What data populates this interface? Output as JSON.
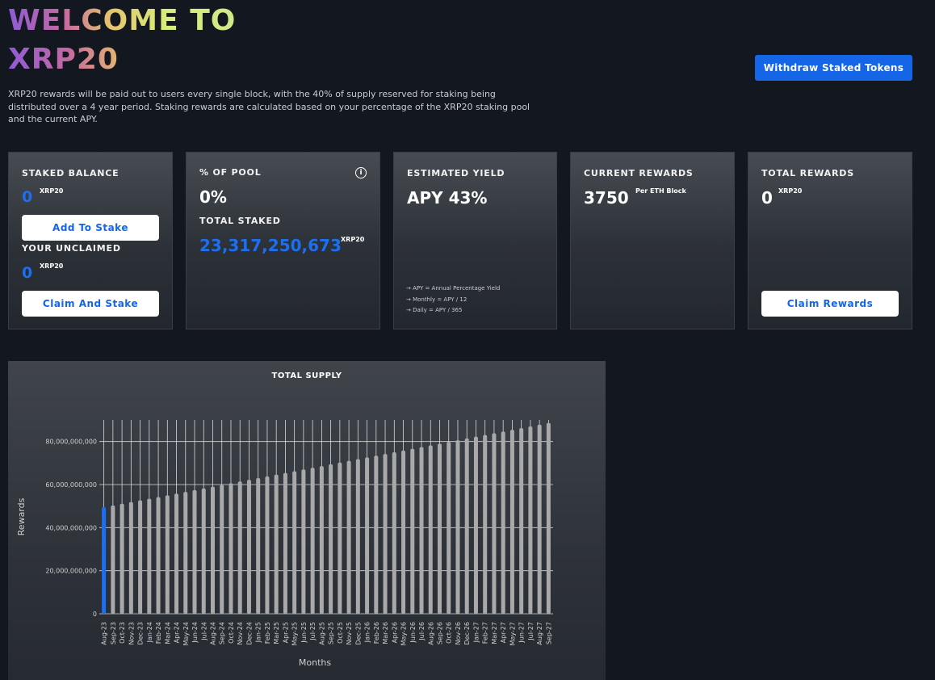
{
  "hero": {
    "title_line1": "WELCOME TO",
    "title_line2": "XRP20",
    "description": "XRP20 rewards will be paid out to users every single block, with the 40% of supply reserved for staking being distributed over a 4 year period. Staking rewards are calculated based on your percentage of the XRP20 staking pool and the current APY."
  },
  "header": {
    "withdraw_label": "Withdraw Staked Tokens"
  },
  "cards": {
    "staked_balance": {
      "label": "STAKED BALANCE",
      "value": "0",
      "unit": "XRP20",
      "add_button": "Add To Stake",
      "unclaimed_label": "YOUR UNCLAIMED",
      "unclaimed_value": "0",
      "unclaimed_unit": "XRP20",
      "claim_stake_button": "Claim And Stake"
    },
    "pool": {
      "label": "% OF POOL",
      "value": "0%",
      "total_staked_label": "TOTAL STAKED",
      "total_staked_value": "23,317,250,673",
      "total_staked_unit": "XRP20",
      "info_icon": "info-icon"
    },
    "yield": {
      "label": "ESTIMATED YIELD",
      "value": "APY 43%",
      "notes": [
        "APY = Annual Percentage Yield",
        "Monthly = APY / 12",
        "Daily = APY / 365"
      ]
    },
    "current_rewards": {
      "label": "CURRENT REWARDS",
      "value": "3750",
      "unit": "Per ETH Block"
    },
    "total_rewards": {
      "label": "TOTAL REWARDS",
      "value": "0",
      "unit": "XRP20",
      "claim_button": "Claim Rewards"
    }
  },
  "colors": {
    "accent": "#1466e6",
    "highlight_bar": "#1c6ff0",
    "bar": "#a9a9a9"
  },
  "chart_data": {
    "type": "bar",
    "title": "TOTAL SUPPLY",
    "xlabel": "Months",
    "ylabel": "Rewards",
    "ylim": [
      0,
      90000000000
    ],
    "yticks": [
      0,
      20000000000,
      40000000000,
      60000000000,
      80000000000
    ],
    "ytick_labels": [
      "0",
      "20,000,000,000",
      "40,000,000,000",
      "60,000,000,000",
      "80,000,000,000"
    ],
    "grid": true,
    "categories": [
      "Aug-23",
      "Sep-23",
      "Oct-23",
      "Nov-23",
      "Dec-23",
      "Jan-24",
      "Feb-24",
      "Mar-24",
      "Apr-24",
      "May-24",
      "Jun-24",
      "Jul-24",
      "Aug-24",
      "Sep-24",
      "Oct-24",
      "Nov-24",
      "Dec-24",
      "Jan-25",
      "Feb-25",
      "Mar-25",
      "Apr-25",
      "May-25",
      "Jun-25",
      "Jul-25",
      "Aug-25",
      "Sep-25",
      "Oct-25",
      "Nov-25",
      "Dec-25",
      "Jan-26",
      "Feb-26",
      "Mar-26",
      "Apr-26",
      "May-26",
      "Jun-26",
      "Jul-26",
      "Aug-26",
      "Sep-26",
      "Oct-26",
      "Nov-26",
      "Dec-26",
      "Jan-27",
      "Feb-27",
      "Mar-27",
      "Apr-27",
      "May-27",
      "Jun-27",
      "Jul-27",
      "Aug-27",
      "Sep-27"
    ],
    "values": [
      49500000000,
      50300000000,
      51100000000,
      51900000000,
      52700000000,
      53400000000,
      54200000000,
      55000000000,
      55800000000,
      56600000000,
      57400000000,
      58200000000,
      59000000000,
      59800000000,
      60600000000,
      61400000000,
      62200000000,
      63000000000,
      63800000000,
      64600000000,
      65400000000,
      66200000000,
      67000000000,
      67800000000,
      68600000000,
      69400000000,
      70200000000,
      71000000000,
      71800000000,
      72600000000,
      73400000000,
      74200000000,
      75000000000,
      75800000000,
      76600000000,
      77400000000,
      78200000000,
      79000000000,
      79800000000,
      80600000000,
      81400000000,
      82200000000,
      83000000000,
      83800000000,
      84600000000,
      85400000000,
      86200000000,
      87000000000,
      87800000000,
      88600000000
    ],
    "highlight_index": 0
  }
}
